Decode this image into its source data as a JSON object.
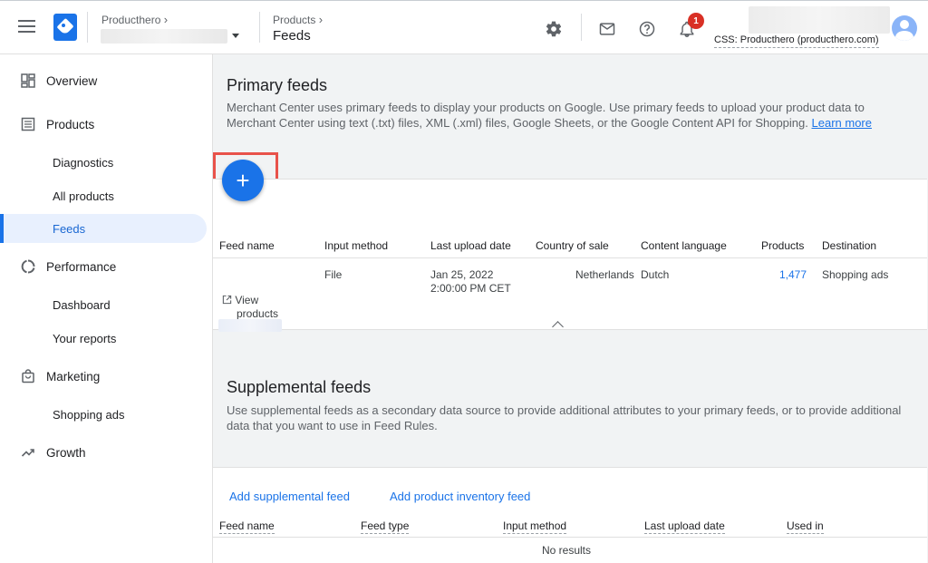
{
  "header": {
    "account_label": "Producthero",
    "section_label": "Products",
    "page_title": "Feeds",
    "notification_count": "1",
    "css_label": "CSS: Producthero (producthero.com)"
  },
  "sidebar": {
    "overview": "Overview",
    "products": "Products",
    "diagnostics": "Diagnostics",
    "all_products": "All products",
    "feeds": "Feeds",
    "performance": "Performance",
    "dashboard": "Dashboard",
    "your_reports": "Your reports",
    "marketing": "Marketing",
    "shopping_ads": "Shopping ads",
    "growth": "Growth"
  },
  "primary": {
    "title": "Primary feeds",
    "description": "Merchant Center uses primary feeds to display your products on Google. Use primary feeds to upload your product data to Merchant Center using text (.txt) files, XML (.xml) files, Google Sheets, or the Google Content API for Shopping.",
    "learn_more": "Learn more",
    "add_symbol": "+",
    "columns": [
      "Feed name",
      "Input method",
      "Last upload date",
      "Country of sale",
      "Content language",
      "Products",
      "Destination"
    ],
    "row": {
      "view_label": "View",
      "products_label": "products",
      "input_method": "File",
      "upload_date": "Jan 25, 2022",
      "upload_time": "2:00:00 PM CET",
      "country": "Netherlands",
      "language": "Dutch",
      "products": "1,477",
      "destination": "Shopping ads"
    }
  },
  "supplemental": {
    "title": "Supplemental feeds",
    "description": "Use supplemental feeds as a secondary data source to provide additional attributes to your primary feeds, or to provide additional data that you want to use in Feed Rules.",
    "add_supplemental": "Add supplemental feed",
    "add_inventory": "Add product inventory feed",
    "columns": [
      "Feed name",
      "Feed type",
      "Input method",
      "Last upload date",
      "Used in"
    ],
    "empty": "No results"
  },
  "colors": {
    "accent": "#1a73e8",
    "highlight_box": "#e8524a",
    "badge": "#d93025"
  }
}
